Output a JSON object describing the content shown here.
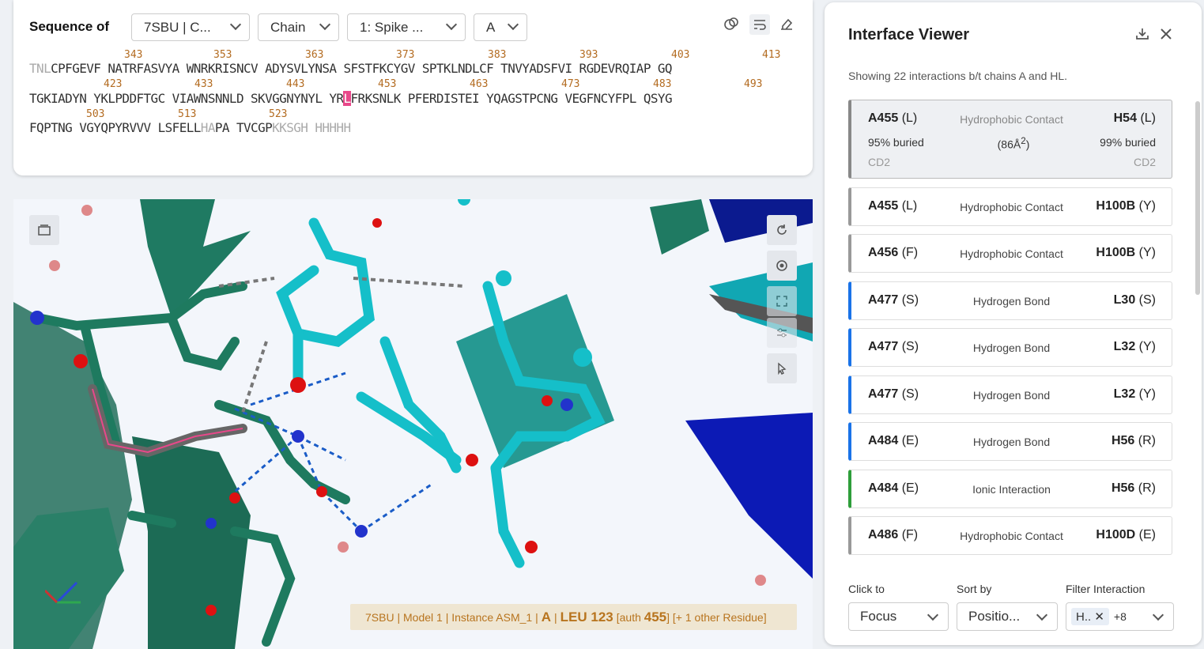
{
  "sequence": {
    "title": "Sequence of",
    "dropdowns": [
      "7SBU | C...",
      "Chain",
      "1: Spike ...",
      "A"
    ],
    "rows": [
      {
        "pre_gray": "TNL",
        "text": "CPFGEVF NATRFASVYA WNRKRISNCV ADYSVLYNSA SFSTFKCYGV SPTKLNDLCF TNVYADSFVI RGDEVRQIAP GQ",
        "hl": "",
        "post": "",
        "post_gray": ""
      },
      {
        "pre_gray": "",
        "text": "TGKIADYN YKLPDDFTGC VIAWNSNNLD SKVGGNYNYL YR",
        "hl": "L",
        "post": "FRKSNLK PFERDISTEI YQAGSTPCNG VEGFNCYFPL QSYG",
        "post_gray": ""
      },
      {
        "pre_gray": "",
        "text": "FQPTNG VGYQPYRVVV LSFELL",
        "hl": "",
        "post": "",
        "post_gray": "HA",
        "tail": "PA TVCGP",
        "tail_gray": "KKSGH HHHHH"
      }
    ],
    "numbers_row1": [
      "343",
      "353",
      "363",
      "373",
      "383",
      "393",
      "403",
      "413"
    ],
    "numbers_row2": [
      "423",
      "433",
      "443",
      "453",
      "463",
      "473",
      "483",
      "493"
    ],
    "numbers_row3": [
      "503",
      "513",
      "523"
    ]
  },
  "viewer": {
    "info": {
      "pdb": "7SBU",
      "model": "Model 1",
      "instance": "Instance ASM_1",
      "chain": "A",
      "residue": "LEU 123",
      "auth_pre": "[auth",
      "auth_num": "455",
      "auth_post": "]",
      "other": "[+ 1 other Residue]"
    }
  },
  "interface": {
    "title": "Interface Viewer",
    "subtitle": "Showing 22 interactions b/t chains A and HL.",
    "selected": {
      "left_id": "A455",
      "left_res": "(L)",
      "type": "Hydrophobic Contact",
      "right_id": "H54",
      "right_res": "(L)",
      "left_buried": "95% buried",
      "area": "(86Å",
      "area_sup": "2",
      "area_close": ")",
      "right_buried": "99% buried",
      "left_atom": "CD2",
      "right_atom": "CD2"
    },
    "cards": [
      {
        "left_id": "A455",
        "left_res": "(L)",
        "type": "Hydrophobic Contact",
        "right_id": "H100B",
        "right_res": "(Y)",
        "color": "#999999"
      },
      {
        "left_id": "A456",
        "left_res": "(F)",
        "type": "Hydrophobic Contact",
        "right_id": "H100B",
        "right_res": "(Y)",
        "color": "#999999"
      },
      {
        "left_id": "A477",
        "left_res": "(S)",
        "type": "Hydrogen Bond",
        "right_id": "L30",
        "right_res": "(S)",
        "color": "#1a73e8"
      },
      {
        "left_id": "A477",
        "left_res": "(S)",
        "type": "Hydrogen Bond",
        "right_id": "L32",
        "right_res": "(Y)",
        "color": "#1a73e8"
      },
      {
        "left_id": "A477",
        "left_res": "(S)",
        "type": "Hydrogen Bond",
        "right_id": "L32",
        "right_res": "(Y)",
        "color": "#1a73e8"
      },
      {
        "left_id": "A484",
        "left_res": "(E)",
        "type": "Hydrogen Bond",
        "right_id": "H56",
        "right_res": "(R)",
        "color": "#1a73e8"
      },
      {
        "left_id": "A484",
        "left_res": "(E)",
        "type": "Ionic Interaction",
        "right_id": "H56",
        "right_res": "(R)",
        "color": "#2e9e3a"
      },
      {
        "left_id": "A486",
        "left_res": "(F)",
        "type": "Hydrophobic Contact",
        "right_id": "H100D",
        "right_res": "(E)",
        "color": "#999999"
      }
    ],
    "controls": {
      "click_label": "Click to",
      "click_value": "Focus",
      "sort_label": "Sort by",
      "sort_value": "Positio...",
      "filter_label": "Filter Interaction",
      "filter_chip": "H..",
      "filter_more": "+8"
    }
  }
}
